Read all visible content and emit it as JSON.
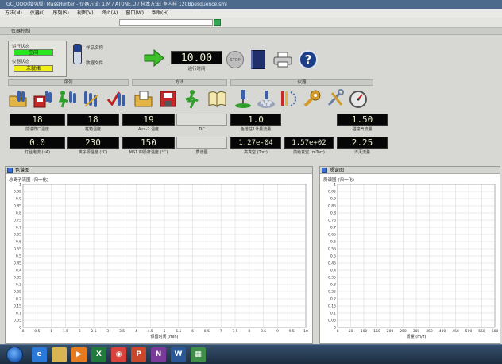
{
  "window": {
    "title": "GC_QQQ(增强版) MassHunter - 仪器方法: 1.M / ATUNE.U / 样本方法: 室内样 120Bpesquence.sml"
  },
  "menu": [
    "方法(M)",
    "仪器(I)",
    "序列(S)",
    "视图(V)",
    "终止(A)",
    "窗口(W)",
    "帮助(H)"
  ],
  "panel": {
    "title": "仪器控制"
  },
  "status": {
    "run_label": "运行状态",
    "run_value": "空闲",
    "run_color": "#27e81f",
    "instrument_label": "仪器状态",
    "instrument_value": "未就绪",
    "instrument_color": "#f2ef16"
  },
  "sample": {
    "name_label": "样品名称",
    "file_label": "数据文件"
  },
  "runtime": {
    "value": "10.00",
    "label": "运行时间",
    "stop_label": "STOP"
  },
  "groups": {
    "sequence": "序列",
    "method": "方法",
    "instrument": "仪器"
  },
  "icons": {
    "sequence": [
      "sequence-open-icon",
      "sequence-save-icon",
      "sequence-run-icon",
      "sequence-edit-icon",
      "sequence-check-icon"
    ],
    "method": [
      "method-open-icon",
      "method-save-icon",
      "method-run-icon",
      "method-book-icon"
    ],
    "instrument": [
      "autosampler-icon",
      "vials-icon",
      "ms-tune-icon",
      "gc-wrench-icon",
      "tools-icon",
      "gauge-icon"
    ]
  },
  "readouts": {
    "inlet_temp": {
      "value": "18",
      "label": "前进样口温度"
    },
    "oven_temp": {
      "value": "18",
      "label": "柱箱温度"
    },
    "aux2_temp": {
      "value": "19",
      "label": "Aux-2 温度"
    },
    "tic": {
      "value": "",
      "label": "TIC"
    },
    "column_flow": {
      "value": "1.0",
      "label": "色谱柱1计量流量"
    },
    "carrier_flow": {
      "value": "1.50",
      "label": "碰撞气流量"
    },
    "filament_current": {
      "value": "0.0",
      "label": "灯丝电流 (uA)"
    },
    "source_temp": {
      "value": "230",
      "label": "离子源温度 (°C)"
    },
    "quad_temp": {
      "value": "150",
      "label": "MS1 四极杆温度 (°C)"
    },
    "quality": {
      "value": "",
      "label": "质谱图"
    },
    "high_vac": {
      "value": "1.27e-04",
      "label": "高真空 (Torr)"
    },
    "fore_vac": {
      "value": "1.57e+02",
      "label": "前级真空 (mTorr)"
    },
    "quench_flow": {
      "value": "2.25",
      "label": "淬灭流量"
    }
  },
  "left_chart": {
    "panel_title": "色谱图",
    "subtitle": "总离子流图 (归一化)",
    "chart_data": {
      "type": "line",
      "series": [],
      "xlabel": "保留时间 (min)",
      "xticks": [
        "0",
        "0.5",
        "1",
        "1.5",
        "2",
        "2.5",
        "3",
        "3.5",
        "4",
        "4.5",
        "5",
        "5.5",
        "6",
        "6.5",
        "7",
        "7.5",
        "8",
        "8.5",
        "9",
        "9.5",
        "10"
      ],
      "yticks": [
        "0",
        "0.05",
        "0.1",
        "0.15",
        "0.2",
        "0.25",
        "0.3",
        "0.35",
        "0.4",
        "0.45",
        "0.5",
        "0.55",
        "0.6",
        "0.65",
        "0.7",
        "0.75",
        "0.8",
        "0.85",
        "0.9",
        "0.95",
        "1"
      ],
      "xlim": [
        0,
        10
      ],
      "ylim": [
        0,
        1
      ],
      "grid": true
    }
  },
  "right_chart": {
    "panel_title": "质谱图",
    "subtitle": "质谱图 (归一化)",
    "chart_data": {
      "type": "line",
      "series": [],
      "xlabel": "质量 (m/z)",
      "xticks": [
        "0",
        "50",
        "100",
        "150",
        "200",
        "250",
        "300",
        "350",
        "400",
        "450",
        "500",
        "550",
        "600"
      ],
      "yticks": [
        "0",
        "0.05",
        "0.1",
        "0.15",
        "0.2",
        "0.25",
        "0.3",
        "0.35",
        "0.4",
        "0.45",
        "0.5",
        "0.55",
        "0.6",
        "0.65",
        "0.7",
        "0.75",
        "0.8",
        "0.85",
        "0.9",
        "0.95",
        "1"
      ],
      "xlim": [
        0,
        600
      ],
      "ylim": [
        0,
        1
      ],
      "grid": true
    }
  },
  "taskbar": {
    "items": [
      {
        "icon": "ie-icon",
        "label": "e",
        "color": "#2a78d8"
      },
      {
        "icon": "folder-icon",
        "label": "",
        "color": "#d9b453"
      },
      {
        "icon": "media-player-icon",
        "label": "▶",
        "color": "#e57b1e"
      },
      {
        "icon": "excel-icon",
        "label": "X",
        "color": "#1f7a3b"
      },
      {
        "icon": "chrome-icon",
        "label": "◉",
        "color": "#d9433b"
      },
      {
        "icon": "powerpoint-icon",
        "label": "P",
        "color": "#c9472b"
      },
      {
        "icon": "onenote-icon",
        "label": "N",
        "color": "#7a3a9c"
      },
      {
        "icon": "word-icon",
        "label": "W",
        "color": "#2b5797"
      },
      {
        "icon": "masshunter-icon",
        "label": "▦",
        "color": "#3f8f4a"
      }
    ]
  }
}
